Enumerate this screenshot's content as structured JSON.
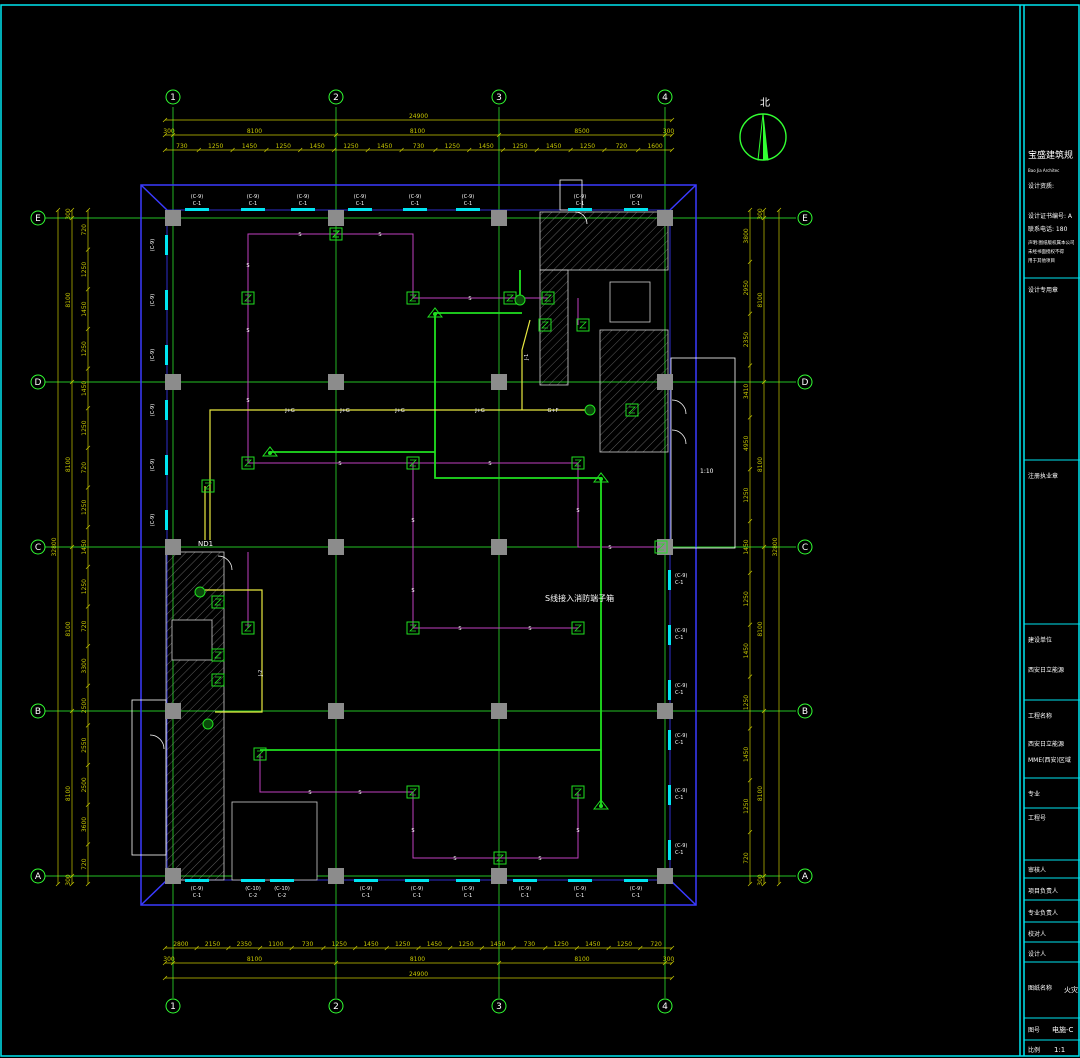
{
  "drawing": {
    "north_label": "北",
    "axis_labels_x": [
      "1",
      "2",
      "3",
      "4"
    ],
    "axis_labels_y": [
      "E",
      "D",
      "C",
      "B",
      "A"
    ],
    "total_width_top": "24900",
    "bays_top": [
      "8100",
      "8100",
      "8100"
    ],
    "bays_top_alt": [
      "8100",
      "8100",
      "8500"
    ],
    "sub_dims_top": [
      "730",
      "1250",
      "1450",
      "1250",
      "1450",
      "1250",
      "1450",
      "730",
      "1250",
      "1450",
      "1250",
      "1450",
      "1250",
      "720",
      "1600"
    ],
    "sub_dims_bottom": [
      "2800",
      "2150",
      "2350",
      "1100",
      "730",
      "1250",
      "1450",
      "1250",
      "1450",
      "1250",
      "1450",
      "730",
      "1250",
      "1450",
      "1250",
      "720"
    ],
    "total_width_bottom": "24900",
    "bays_bottom": [
      "8100",
      "8100",
      "8100"
    ],
    "edge_dim": "300",
    "dims_left_main": [
      "8100",
      "8100",
      "8100",
      "8100"
    ],
    "dims_left_total": "32800",
    "dims_left_sub": [
      "720",
      "1250",
      "1450",
      "1250",
      "1450",
      "1250",
      "720",
      "1250",
      "1450",
      "1250",
      "720",
      "3300",
      "2500",
      "2550",
      "2500",
      "3600",
      "720"
    ],
    "dims_right": [
      "3800",
      "2950",
      "2350",
      "3410",
      "4950",
      "1250",
      "1450",
      "1250",
      "1450",
      "1250",
      "1450",
      "1250",
      "720"
    ],
    "dims_right_main": [
      "8100",
      "8100",
      "8100",
      "8100"
    ],
    "dims_right_total": "32800",
    "window_tags": [
      "(C-9)",
      "C-1",
      "(C-8)",
      "C-1",
      "(C-10)",
      "C-2",
      "C-1(D)"
    ],
    "wire_labels": [
      "S",
      "J+G",
      "G+F",
      "J-1",
      "J-2"
    ],
    "note_text": "S线接入消防端子箱",
    "ramp_text": "1:10",
    "nd_label": "ND1",
    "room_labels": [
      "ND1",
      "1:10"
    ]
  },
  "title_block": {
    "company": "宝盛建筑规",
    "company_en": "Bao Jia Architec",
    "design_qualification": "设计资质:",
    "qualification_no": "设计证书编号: A",
    "phone": "联系电话: 180",
    "notes": [
      "声明:图纸版权属本公司",
      "未经书面授权不得",
      "用于其他项目"
    ],
    "design_seal": "设计专用章",
    "registered_seal": "注册执业章",
    "construction_unit_label": "建设单位",
    "construction_unit": "西安日立能源",
    "project_name_label": "工程名称",
    "project_name_1": "西安日立能源",
    "project_name_2": "MME(西安)区域",
    "discipline": "专业",
    "project_no": "工程号",
    "reviewer": "审核人",
    "project_lead": "项目负责人",
    "discipline_lead": "专业负责人",
    "checker": "校对人",
    "designer": "设计人",
    "drawing_name_label": "图纸名称",
    "drawing_name": "火灾",
    "drawing_no_label": "图号",
    "drawing_no": "电施-C",
    "scale_label": "比例",
    "scale": "1:1"
  },
  "colors": {
    "background": "#000000",
    "frame": "#00e5f0",
    "axis": "#32ff32",
    "wall": "#3a3aff",
    "dimension": "#c8c800",
    "pink_wire": "#c040c0",
    "green_wire": "#20e020",
    "yellow_wire": "#e8e840",
    "column": "#8c8c8c",
    "title_text": "#ffffff"
  }
}
